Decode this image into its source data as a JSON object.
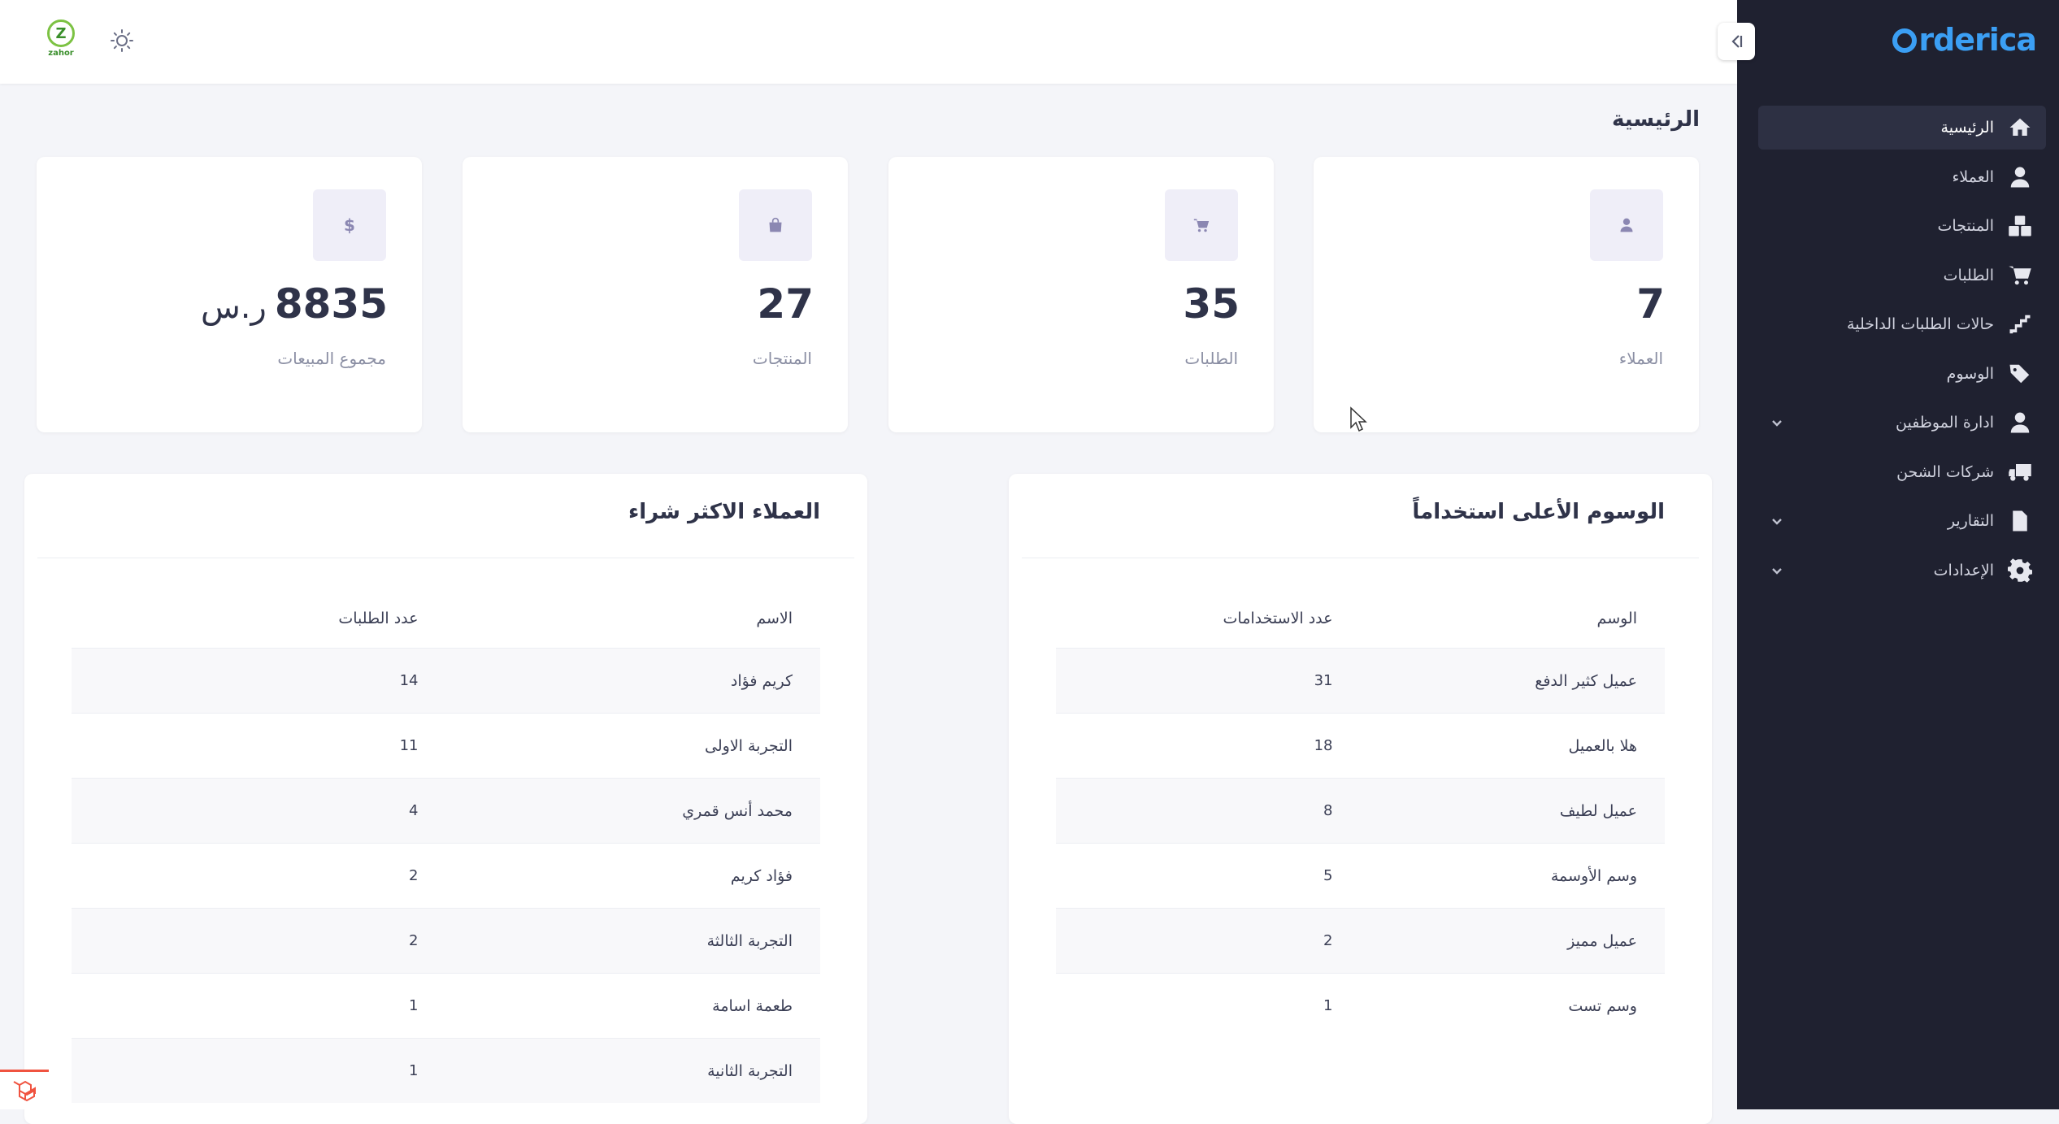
{
  "brand": {
    "name": "rderica",
    "logo_color": "#3b9ff4"
  },
  "sidebar": {
    "items": [
      {
        "label": "الرئيسية",
        "icon": "home-icon",
        "active": true
      },
      {
        "label": "العملاء",
        "icon": "user-icon"
      },
      {
        "label": "المنتجات",
        "icon": "boxes-icon"
      },
      {
        "label": "الطلبات",
        "icon": "cart-icon"
      },
      {
        "label": "حالات الطلبات الداخلية",
        "icon": "stairs-icon"
      },
      {
        "label": "الوسوم",
        "icon": "tags-icon"
      },
      {
        "label": "ادارة الموظفين",
        "icon": "user-icon",
        "has_submenu": true
      },
      {
        "label": "شركات الشحن",
        "icon": "truck-icon"
      },
      {
        "label": "التقارير",
        "icon": "file-icon",
        "has_submenu": true
      },
      {
        "label": "الإعدادات",
        "icon": "gear-icon",
        "has_submenu": true
      }
    ]
  },
  "topbar": {
    "logo_letter": "Z",
    "logo_text": "zahor"
  },
  "page": {
    "title": "الرئيسية"
  },
  "stats": [
    {
      "value": "7",
      "label": "العملاء",
      "icon": "user-icon"
    },
    {
      "value": "35",
      "label": "الطلبات",
      "icon": "cart-icon"
    },
    {
      "value": "27",
      "label": "المنتجات",
      "icon": "bag-icon"
    },
    {
      "value": "8835",
      "unit": "ر.س",
      "label": "مجموع المبيعات",
      "icon": "dollar-icon",
      "icon_glyph": "$"
    }
  ],
  "tags_panel": {
    "title": "الوسوم الأعلى استخداماً",
    "columns": [
      "الوسم",
      "عدد الاستخدامات"
    ],
    "rows": [
      [
        "عميل كثير الدفع",
        "31"
      ],
      [
        "هلا بالعميل",
        "18"
      ],
      [
        "عميل لطيف",
        "8"
      ],
      [
        "وسم الأوسمة",
        "5"
      ],
      [
        "عميل مميز",
        "2"
      ],
      [
        "وسم تست",
        "1"
      ]
    ]
  },
  "customers_panel": {
    "title": "العملاء الاكثر شراء",
    "columns": [
      "الاسم",
      "عدد الطلبات"
    ],
    "rows": [
      [
        "كريم فؤاد",
        "14"
      ],
      [
        "التجربة الاولى",
        "11"
      ],
      [
        "محمد أنس قمري",
        "4"
      ],
      [
        "فؤاد كريم",
        "2"
      ],
      [
        "التجربة الثالثة",
        "2"
      ],
      [
        "طعمة اسامة",
        "1"
      ],
      [
        "التجربة الثانية",
        "1"
      ]
    ]
  }
}
